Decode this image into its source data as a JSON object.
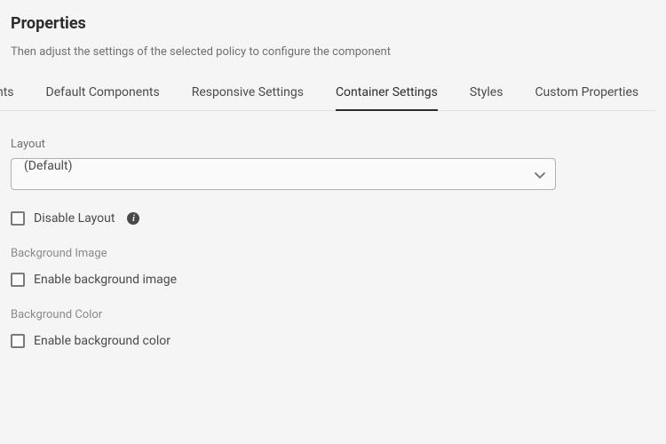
{
  "header": {
    "title": "Properties",
    "subtitle": "Then adjust the settings of the selected policy to configure the component"
  },
  "tabs": {
    "t0": "nts",
    "t1": "Default Components",
    "t2": "Responsive Settings",
    "t3": "Container Settings",
    "t4": "Styles",
    "t5": "Custom Properties"
  },
  "layout": {
    "label": "Layout",
    "value": "(Default)",
    "disable_label": "Disable Layout"
  },
  "bgImage": {
    "heading": "Background Image",
    "enable_label": "Enable background image"
  },
  "bgColor": {
    "heading": "Background Color",
    "enable_label": "Enable background color"
  }
}
